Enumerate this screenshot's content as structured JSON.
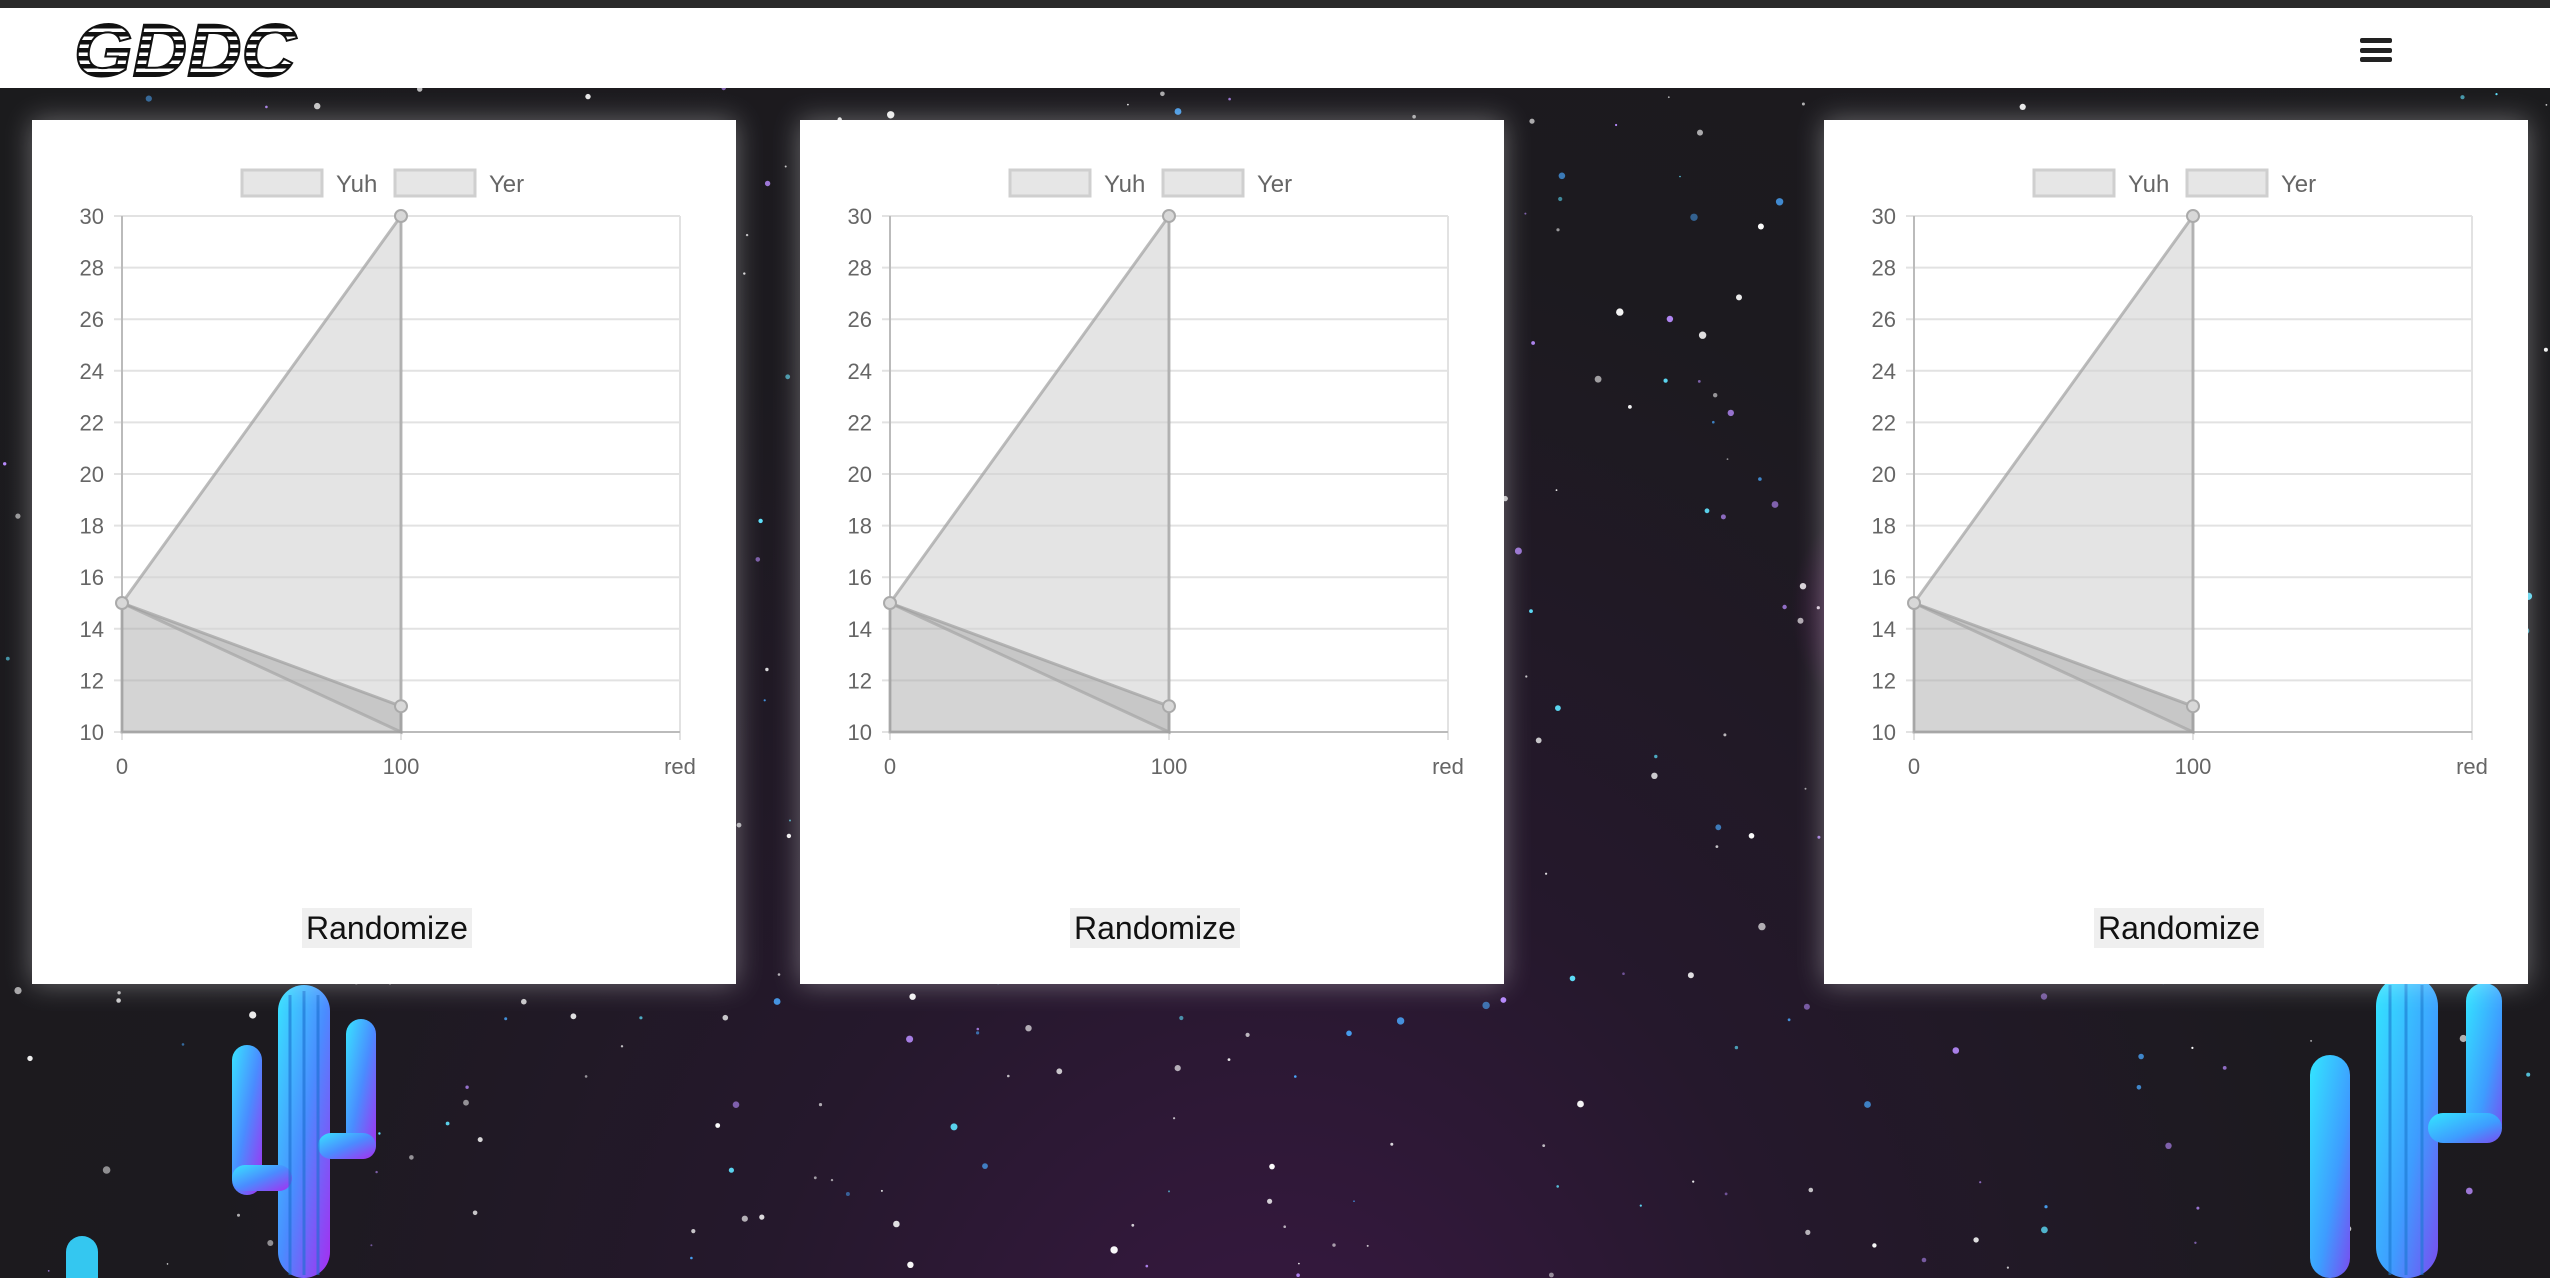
{
  "header": {
    "logo_text": "GDDC",
    "menu_icon": "hamburger-menu-icon"
  },
  "colors": {
    "header_bg": "#ffffff",
    "page_bg": "#1b1b1d",
    "card_bg": "#ffffff",
    "series_fill": "#e3e3e3",
    "series2_fill": "#cfcfcf",
    "grid": "#e0e0e0"
  },
  "cards": [
    {
      "button_label": "Randomize",
      "chart_data": {
        "type": "area",
        "legend": [
          "Yuh",
          "Yer"
        ],
        "x_ticks": [
          "0",
          "100",
          "red"
        ],
        "y_ticks": [
          "10",
          "12",
          "14",
          "16",
          "18",
          "20",
          "22",
          "24",
          "26",
          "28",
          "30"
        ],
        "ylim": [
          10,
          30
        ],
        "series": [
          {
            "name": "Yuh",
            "points": [
              [
                0,
                15
              ],
              [
                100,
                30
              ],
              [
                100,
                10
              ]
            ]
          },
          {
            "name": "Yer",
            "points": [
              [
                0,
                15
              ],
              [
                100,
                11
              ],
              [
                100,
                10
              ],
              [
                0,
                10
              ]
            ]
          }
        ],
        "legend_position": "top",
        "grid": true
      }
    },
    {
      "button_label": "Randomize",
      "chart_data": {
        "type": "area",
        "legend": [
          "Yuh",
          "Yer"
        ],
        "x_ticks": [
          "0",
          "100",
          "red"
        ],
        "y_ticks": [
          "10",
          "12",
          "14",
          "16",
          "18",
          "20",
          "22",
          "24",
          "26",
          "28",
          "30"
        ],
        "ylim": [
          10,
          30
        ],
        "series": [
          {
            "name": "Yuh",
            "points": [
              [
                0,
                15
              ],
              [
                100,
                30
              ],
              [
                100,
                10
              ]
            ]
          },
          {
            "name": "Yer",
            "points": [
              [
                0,
                15
              ],
              [
                100,
                11
              ],
              [
                100,
                10
              ],
              [
                0,
                10
              ]
            ]
          }
        ],
        "legend_position": "top",
        "grid": true
      }
    },
    {
      "button_label": "Randomize",
      "chart_data": {
        "type": "area",
        "legend": [
          "Yuh",
          "Yer"
        ],
        "x_ticks": [
          "0",
          "100",
          "red"
        ],
        "y_ticks": [
          "10",
          "12",
          "14",
          "16",
          "18",
          "20",
          "22",
          "24",
          "26",
          "28",
          "30"
        ],
        "ylim": [
          10,
          30
        ],
        "series": [
          {
            "name": "Yuh",
            "points": [
              [
                0,
                15
              ],
              [
                100,
                30
              ],
              [
                100,
                10
              ]
            ]
          },
          {
            "name": "Yer",
            "points": [
              [
                0,
                15
              ],
              [
                100,
                11
              ],
              [
                100,
                10
              ],
              [
                0,
                10
              ]
            ]
          }
        ],
        "legend_position": "top",
        "grid": true
      }
    }
  ]
}
